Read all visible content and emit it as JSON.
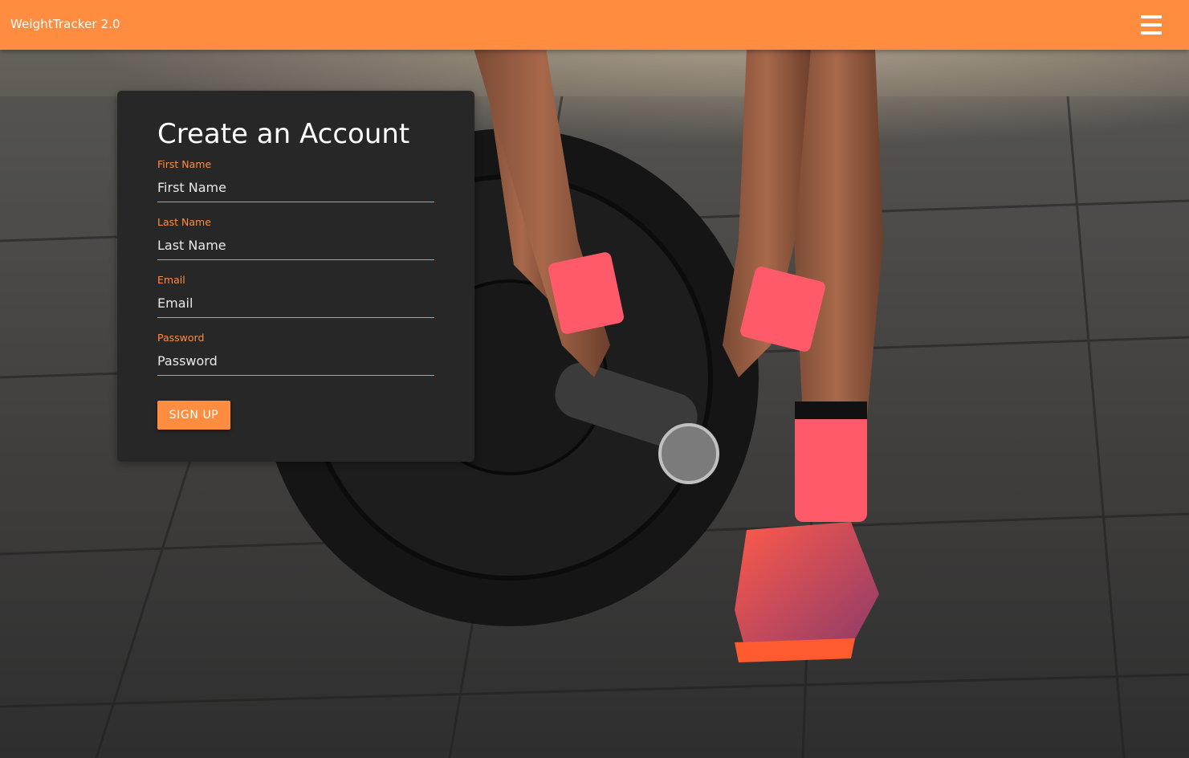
{
  "navbar": {
    "brand": "WeightTracker 2.0",
    "menu_icon": "hamburger-menu-icon"
  },
  "form": {
    "title": "Create an Account",
    "fields": [
      {
        "label": "First Name",
        "placeholder": "First Name",
        "value": "",
        "type": "text"
      },
      {
        "label": "Last Name",
        "placeholder": "Last Name",
        "value": "",
        "type": "text"
      },
      {
        "label": "Email",
        "placeholder": "Email",
        "value": "",
        "type": "email"
      },
      {
        "label": "Password",
        "placeholder": "Password",
        "value": "",
        "type": "password"
      }
    ],
    "submit_label": "SIGN UP"
  },
  "background": {
    "subject": "athlete-loading-barbell-photo"
  },
  "colors": {
    "accent": "#ff8c3f",
    "card": "#272727",
    "text": "#ffffff"
  }
}
